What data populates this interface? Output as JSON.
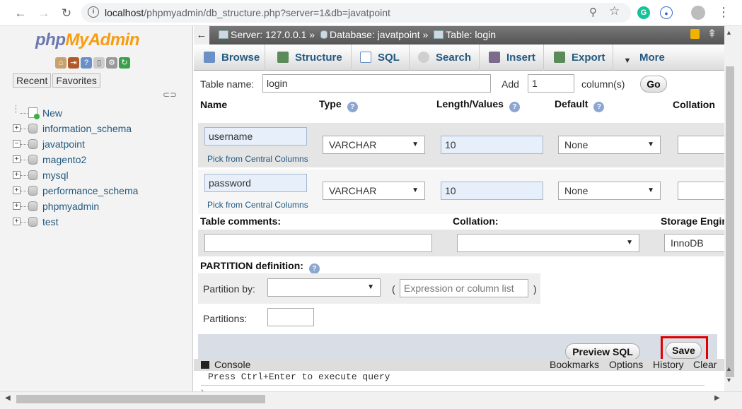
{
  "browser": {
    "url_host": "localhost",
    "url_path": "/phpmyadmin/db_structure.php?server=1&db=javatpoint"
  },
  "leftnav": {
    "logo_php": "php",
    "logo_my": "MyAdmin",
    "recent": "Recent",
    "favorites": "Favorites",
    "tree": [
      {
        "label": "New"
      },
      {
        "label": "information_schema"
      },
      {
        "label": "javatpoint"
      },
      {
        "label": "magento2"
      },
      {
        "label": "mysql"
      },
      {
        "label": "performance_schema"
      },
      {
        "label": "phpmyadmin"
      },
      {
        "label": "test"
      }
    ]
  },
  "breadcrumb": {
    "server": "Server: 127.0.0.1 »",
    "database": "Database: javatpoint »",
    "table": "Table: login"
  },
  "tabs": {
    "browse": "Browse",
    "structure": "Structure",
    "sql": "SQL",
    "search": "Search",
    "insert": "Insert",
    "export": "Export",
    "more": "More"
  },
  "form": {
    "table_name_label": "Table name:",
    "table_name_value": "login",
    "add_label": "Add",
    "add_value": "1",
    "columns_label": "column(s)",
    "go_label": "Go",
    "headers": {
      "name": "Name",
      "type": "Type",
      "length": "Length/Values",
      "default": "Default",
      "collation": "Collation"
    },
    "columns": [
      {
        "name": "username",
        "type": "VARCHAR",
        "length": "10",
        "default": "None",
        "pick": "Pick from Central Columns"
      },
      {
        "name": "password",
        "type": "VARCHAR",
        "length": "10",
        "default": "None",
        "pick": "Pick from Central Columns"
      }
    ],
    "table_comments_label": "Table comments:",
    "collation_label": "Collation:",
    "storage_engine_label": "Storage Engine",
    "storage_engine_value": "InnoDB",
    "partition_label": "PARTITION definition:",
    "partition_by_label": "Partition by:",
    "open_paren": "(",
    "close_paren": ")",
    "expression_placeholder": "Expression or column list",
    "partitions_label": "Partitions:",
    "preview_sql": "Preview SQL",
    "save": "Save"
  },
  "console": {
    "title": "Console",
    "bookmarks": "Bookmarks",
    "options": "Options",
    "history": "History",
    "clear": "Clear",
    "hint": "Press Ctrl+Enter to execute query"
  },
  "colors": {
    "link": "#235a81",
    "highlight": "#e00000",
    "topbar": "#666666"
  }
}
